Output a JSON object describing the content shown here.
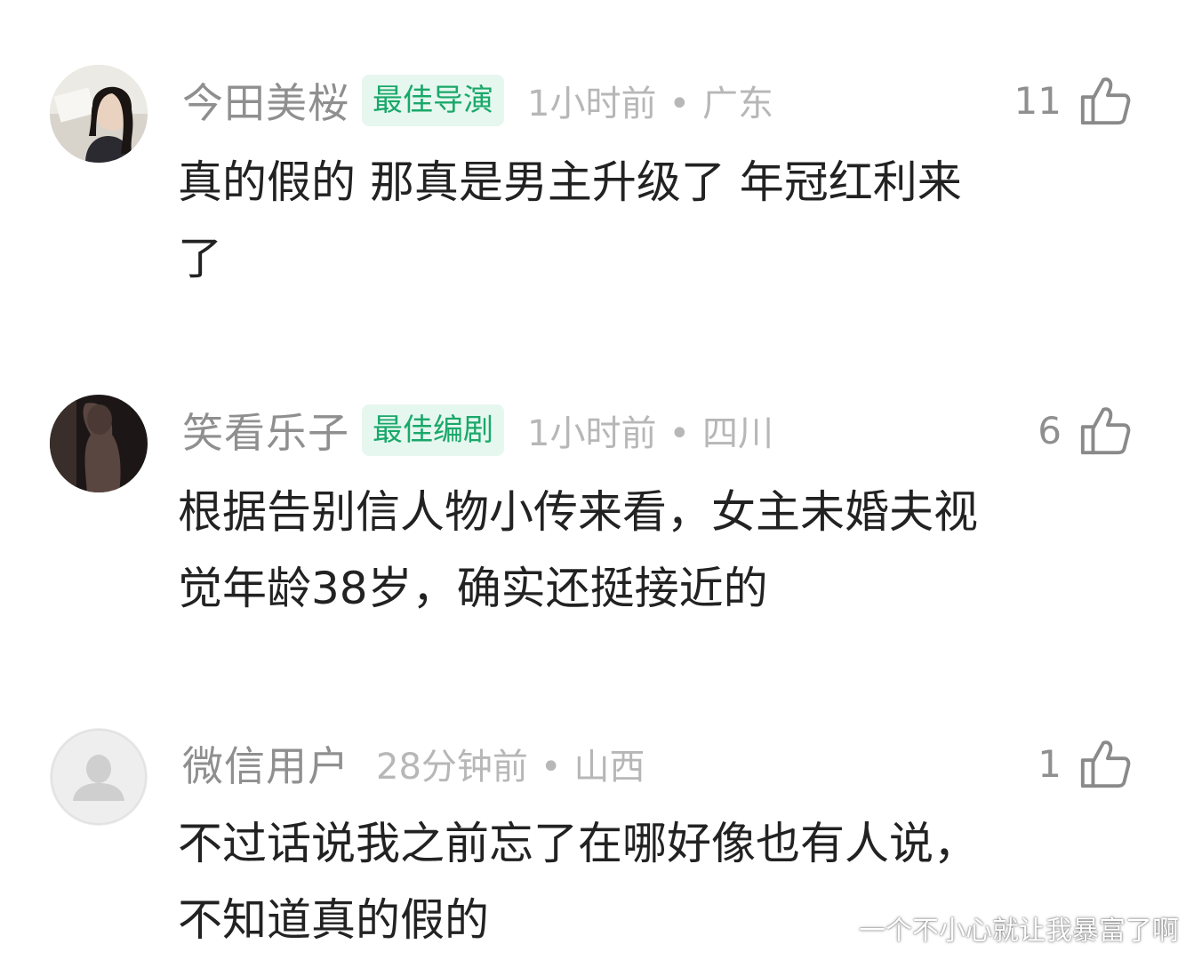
{
  "comments": [
    {
      "username": "今田美桜",
      "badge": "最佳导演",
      "time": "1小时前",
      "location": "广东",
      "likes": "11",
      "text": "真的假的 那真是男主升级了 年冠红利来\n了"
    },
    {
      "username": "笑看乐子",
      "badge": "最佳编剧",
      "time": "1小时前",
      "location": "四川",
      "likes": "6",
      "text": "根据告别信人物小传来看，女主未婚夫视\n觉年龄38岁，确实还挺接近的"
    },
    {
      "username": "微信用户",
      "badge": "",
      "time": "28分钟前",
      "location": "山西",
      "likes": "1",
      "text": "不过话说我之前忘了在哪好像也有人说，\n不知道真的假的"
    }
  ],
  "separator": "•",
  "watermark": "一个不小心就让我暴富了啊",
  "icons": {
    "like": "thumbs-up-icon",
    "default_avatar": "person-silhouette-icon"
  },
  "colors": {
    "badge_bg": "#e6f7ef",
    "badge_text": "#1aa86a",
    "username": "#8f8f8f",
    "meta": "#b7b7b7",
    "text": "#222222"
  }
}
